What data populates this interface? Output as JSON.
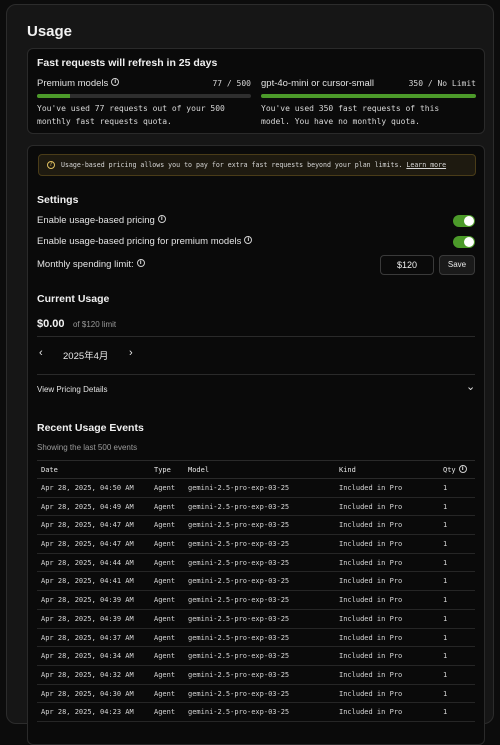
{
  "page": {
    "title": "Usage"
  },
  "quota": {
    "title": "Fast requests will refresh in 25 days",
    "premium": {
      "label": "Premium models",
      "count": "77 / 500",
      "used": 77,
      "total": 500,
      "desc_line1": "You've used 77 requests out of your 500",
      "desc_line2": "monthly fast requests quota."
    },
    "small": {
      "label": "gpt-4o-mini or cursor-small",
      "count": "350 / No Limit",
      "fill_fraction": 1.0,
      "desc_line1": "You've used 350 fast requests of this",
      "desc_line2": "model. You have no monthly quota."
    }
  },
  "banner": {
    "text": "Usage-based pricing allows you to pay for extra fast requests beyond your plan limits. ",
    "link": "Learn more"
  },
  "settings": {
    "title": "Settings",
    "enable_label": "Enable usage-based pricing",
    "enable_on": true,
    "premium_label": "Enable usage-based pricing for premium models",
    "premium_on": true,
    "limit_label": "Monthly spending limit:",
    "limit_value": "$120",
    "save_label": "Save"
  },
  "current": {
    "title": "Current Usage",
    "amount": "$0.00",
    "limit_text": "of $120 limit",
    "month": "2025年4月",
    "prev_icon": "‹",
    "next_icon": "›",
    "pricing_details": "View Pricing Details",
    "expand_icon": "⌄"
  },
  "events": {
    "title": "Recent Usage Events",
    "subtitle": "Showing the last 500 events",
    "columns": [
      "Date",
      "Type",
      "Model",
      "Kind",
      "Qty"
    ],
    "rows": [
      [
        "Apr 28, 2025, 04:50 AM",
        "Agent",
        "gemini-2.5-pro-exp-03-25",
        "Included in Pro",
        "1"
      ],
      [
        "Apr 28, 2025, 04:49 AM",
        "Agent",
        "gemini-2.5-pro-exp-03-25",
        "Included in Pro",
        "1"
      ],
      [
        "Apr 28, 2025, 04:47 AM",
        "Agent",
        "gemini-2.5-pro-exp-03-25",
        "Included in Pro",
        "1"
      ],
      [
        "Apr 28, 2025, 04:47 AM",
        "Agent",
        "gemini-2.5-pro-exp-03-25",
        "Included in Pro",
        "1"
      ],
      [
        "Apr 28, 2025, 04:44 AM",
        "Agent",
        "gemini-2.5-pro-exp-03-25",
        "Included in Pro",
        "1"
      ],
      [
        "Apr 28, 2025, 04:41 AM",
        "Agent",
        "gemini-2.5-pro-exp-03-25",
        "Included in Pro",
        "1"
      ],
      [
        "Apr 28, 2025, 04:39 AM",
        "Agent",
        "gemini-2.5-pro-exp-03-25",
        "Included in Pro",
        "1"
      ],
      [
        "Apr 28, 2025, 04:39 AM",
        "Agent",
        "gemini-2.5-pro-exp-03-25",
        "Included in Pro",
        "1"
      ],
      [
        "Apr 28, 2025, 04:37 AM",
        "Agent",
        "gemini-2.5-pro-exp-03-25",
        "Included in Pro",
        "1"
      ],
      [
        "Apr 28, 2025, 04:34 AM",
        "Agent",
        "gemini-2.5-pro-exp-03-25",
        "Included in Pro",
        "1"
      ],
      [
        "Apr 28, 2025, 04:32 AM",
        "Agent",
        "gemini-2.5-pro-exp-03-25",
        "Included in Pro",
        "1"
      ],
      [
        "Apr 28, 2025, 04:30 AM",
        "Agent",
        "gemini-2.5-pro-exp-03-25",
        "Included in Pro",
        "1"
      ],
      [
        "Apr 28, 2025, 04:23 AM",
        "Agent",
        "gemini-2.5-pro-exp-03-25",
        "Included in Pro",
        "1"
      ]
    ]
  },
  "colors": {
    "accent": "#4c9a2a",
    "banner_bg": "#1e1a10",
    "background": "#0c0c0c"
  }
}
